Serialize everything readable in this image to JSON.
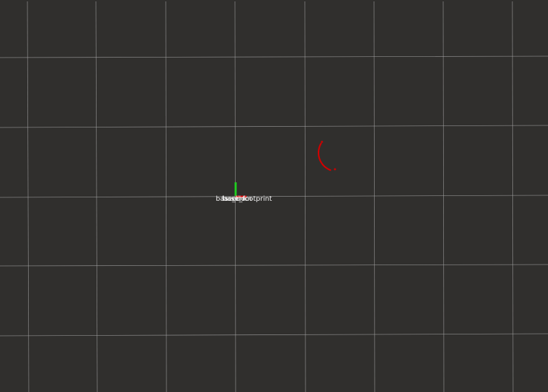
{
  "viewer": {
    "background_color": "#302f2d",
    "grid_color": "#a0a0a0",
    "grid": true
  },
  "tf_frames": {
    "labels": [
      "base_link",
      "laser",
      "odom",
      "base_footprint"
    ],
    "x_axis_color": "#e01010",
    "y_axis_color": "#20d020"
  },
  "laser_scan": {
    "color": "#d00000",
    "shape": "arc"
  }
}
